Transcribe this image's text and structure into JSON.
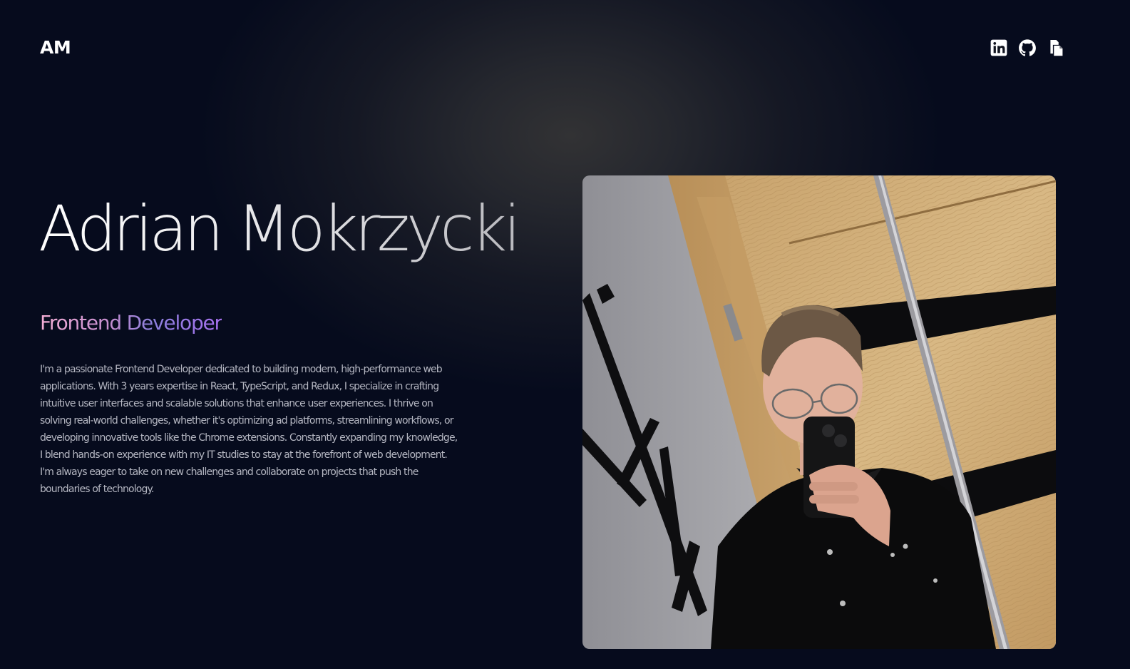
{
  "header": {
    "logo": "AM",
    "social_icons": [
      "linkedin-icon",
      "github-icon",
      "resume-document-icon"
    ]
  },
  "hero": {
    "name": "Adrian Mokrzycki",
    "role": "Frontend Developer",
    "bio": "I'm a passionate Frontend Developer dedicated to building modern, high-performance web applications. With 3 years expertise in React, TypeScript, and Redux, I specialize in crafting intuitive user interfaces and scalable solutions that enhance user experiences. I thrive on solving real-world challenges, whether it's optimizing ad platforms, streamlining workflows, or developing innovative tools like the Chrome extensions. Constantly expanding my knowledge, I blend hands-on experience with my IT studies to stay at the forefront of web development. I'm always eager to take on new challenges and collaborate on projects that push the boundaries of technology."
  },
  "colors": {
    "background": "#050a1c",
    "spotlight": "#323234",
    "role_gradient_start": "#f4aed5",
    "role_gradient_end": "#a871f0",
    "bio_text": "#b5b7c2"
  }
}
